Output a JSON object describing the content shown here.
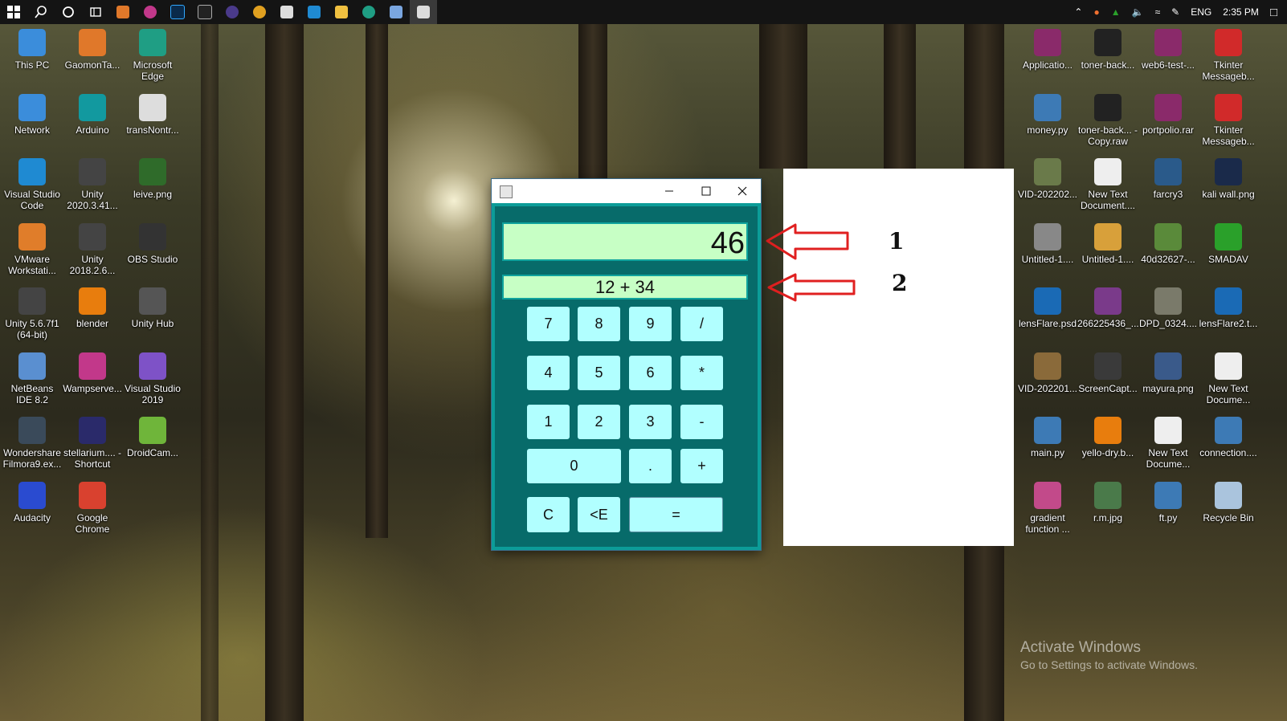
{
  "taskbar": {
    "language": "ENG",
    "time": "2:35 PM"
  },
  "desktop_left": [
    {
      "label": "This PC",
      "icon": "monitor-icon",
      "color": "#3b8ddb"
    },
    {
      "label": "GaomonTa...",
      "icon": "gaomon-icon",
      "color": "#e0782a"
    },
    {
      "label": "Microsoft Edge",
      "icon": "edge-icon",
      "color": "#1f9e84"
    },
    {
      "label": "Network",
      "icon": "network-icon",
      "color": "#3b8ddb"
    },
    {
      "label": "Arduino",
      "icon": "arduino-icon",
      "color": "#12999f"
    },
    {
      "label": "transNontr...",
      "icon": "file-icon",
      "color": "#dddddd"
    },
    {
      "label": "Visual Studio Code",
      "icon": "vscode-icon",
      "color": "#1f8ad2"
    },
    {
      "label": "Unity 2020.3.41...",
      "icon": "unity-icon",
      "color": "#444444"
    },
    {
      "label": "leive.png",
      "icon": "image-icon",
      "color": "#2f6b2a"
    },
    {
      "label": "VMware Workstati...",
      "icon": "vmware-icon",
      "color": "#e07d2a"
    },
    {
      "label": "Unity 2018.2.6...",
      "icon": "unity-icon",
      "color": "#444444"
    },
    {
      "label": "OBS Studio",
      "icon": "obs-icon",
      "color": "#333333"
    },
    {
      "label": "Unity 5.6.7f1 (64-bit)",
      "icon": "unity-icon",
      "color": "#444444"
    },
    {
      "label": "blender",
      "icon": "blender-icon",
      "color": "#e87d0d"
    },
    {
      "label": "Unity Hub",
      "icon": "unity-hub-icon",
      "color": "#555555"
    },
    {
      "label": "NetBeans IDE 8.2",
      "icon": "netbeans-icon",
      "color": "#5a8fd0"
    },
    {
      "label": "Wampserve...",
      "icon": "wamp-icon",
      "color": "#c2388a"
    },
    {
      "label": "Visual Studio 2019",
      "icon": "visual-studio-icon",
      "color": "#7e52c7"
    },
    {
      "label": "Wondershare Filmora9.ex...",
      "icon": "filmora-icon",
      "color": "#3a4a5a"
    },
    {
      "label": "stellarium.... - Shortcut",
      "icon": "stellarium-icon",
      "color": "#2a2a6a"
    },
    {
      "label": "DroidCam...",
      "icon": "droidcam-icon",
      "color": "#6fb53a"
    },
    {
      "label": "Audacity",
      "icon": "audacity-icon",
      "color": "#2a4bd0"
    },
    {
      "label": "Google Chrome",
      "icon": "chrome-icon",
      "color": "#d9412f"
    }
  ],
  "desktop_right": [
    {
      "label": "Applicatio...",
      "icon": "rar-icon",
      "color": "#8a2a6a"
    },
    {
      "label": "toner-back...",
      "icon": "image-icon",
      "color": "#222222"
    },
    {
      "label": "web6-test-...",
      "icon": "rar-icon",
      "color": "#8a2a6a"
    },
    {
      "label": "Tkinter Messageb...",
      "icon": "pdf-icon",
      "color": "#d12a2a"
    },
    {
      "label": "money.py",
      "icon": "python-icon",
      "color": "#3d7ab5"
    },
    {
      "label": "toner-back... - Copy.raw",
      "icon": "image-icon",
      "color": "#222222"
    },
    {
      "label": "portpolio.rar",
      "icon": "rar-icon",
      "color": "#8a2a6a"
    },
    {
      "label": "Tkinter Messageb...",
      "icon": "pdf-icon",
      "color": "#d12a2a"
    },
    {
      "label": "VID-202202...",
      "icon": "video-icon",
      "color": "#6a7a4a"
    },
    {
      "label": "New Text Document....",
      "icon": "text-file-icon",
      "color": "#eeeeee"
    },
    {
      "label": "farcry3",
      "icon": "game-icon",
      "color": "#2a5a8a"
    },
    {
      "label": "kali wall.png",
      "icon": "image-icon",
      "color": "#1a2a4a"
    },
    {
      "label": "Untitled-1....",
      "icon": "image-icon",
      "color": "#888888"
    },
    {
      "label": "Untitled-1....",
      "icon": "image-icon",
      "color": "#d8a03a"
    },
    {
      "label": "40d32627-...",
      "icon": "image-icon",
      "color": "#5a8a3a"
    },
    {
      "label": "SMADAV",
      "icon": "smadav-icon",
      "color": "#2aa02a"
    },
    {
      "label": "lensFlare.psd",
      "icon": "psd-icon",
      "color": "#1a6ab5"
    },
    {
      "label": "266225436_...",
      "icon": "image-icon",
      "color": "#7a3a8a"
    },
    {
      "label": "DPD_0324....",
      "icon": "image-icon",
      "color": "#7a7a6a"
    },
    {
      "label": "lensFlare2.t...",
      "icon": "psd-icon",
      "color": "#1a6ab5"
    },
    {
      "label": "VID-202201...",
      "icon": "video-icon",
      "color": "#8a6a3a"
    },
    {
      "label": "ScreenCapt...",
      "icon": "image-icon",
      "color": "#3a3a3a"
    },
    {
      "label": "mayura.png",
      "icon": "image-icon",
      "color": "#3a5a8a"
    },
    {
      "label": "New Text Docume...",
      "icon": "text-file-icon",
      "color": "#eeeeee"
    },
    {
      "label": "main.py",
      "icon": "python-icon",
      "color": "#3d7ab5"
    },
    {
      "label": "yello-dry.b...",
      "icon": "blender-icon",
      "color": "#e87d0d"
    },
    {
      "label": "New Text Docume...",
      "icon": "text-file-icon",
      "color": "#eeeeee"
    },
    {
      "label": "connection....",
      "icon": "python-icon",
      "color": "#3d7ab5"
    },
    {
      "label": "gradient function ...",
      "icon": "image-icon",
      "color": "#c24a8a"
    },
    {
      "label": "r.m.jpg",
      "icon": "image-icon",
      "color": "#4a7a4a"
    },
    {
      "label": "ft.py",
      "icon": "python-icon",
      "color": "#3d7ab5"
    },
    {
      "label": "Recycle Bin",
      "icon": "recycle-bin-icon",
      "color": "#aac4dd"
    }
  ],
  "calculator": {
    "result": "46",
    "expression": "12 + 34",
    "colors": {
      "body": "#076b6a",
      "display": "#c7ffc5",
      "button": "#b1ffff"
    },
    "buttons": {
      "b7": "7",
      "b8": "8",
      "b9": "9",
      "div": "/",
      "b4": "4",
      "b5": "5",
      "b6": "6",
      "mul": "*",
      "b1": "1",
      "b2": "2",
      "b3": "3",
      "sub": "-",
      "b0": "0",
      "dot": ".",
      "add": "+",
      "clear": "C",
      "back": "<E",
      "eq": "="
    }
  },
  "annotations": {
    "label1": "1",
    "label2": "2",
    "arrow_color": "#e02020"
  },
  "watermark": {
    "title": "Activate Windows",
    "subtitle": "Go to Settings to activate Windows."
  }
}
